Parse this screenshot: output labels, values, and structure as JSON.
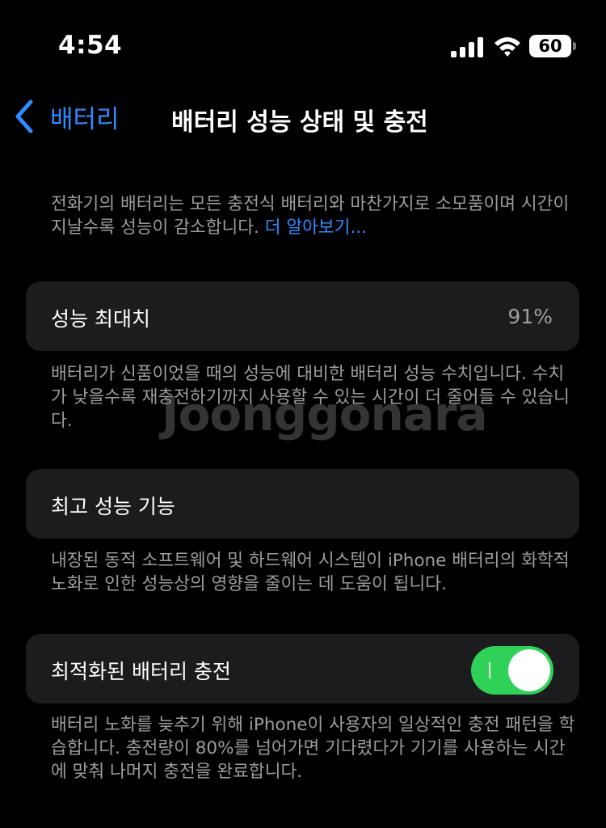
{
  "status_bar": {
    "time": "4:54",
    "battery_level": "60",
    "icons": [
      "signal-icon",
      "wifi-icon",
      "battery-icon"
    ]
  },
  "nav": {
    "back_label": "배터리",
    "title": "배터리 성능 상태 및 충전",
    "back_icon": "chevron-left-icon"
  },
  "intro": {
    "text": "전화기의 배터리는 모든 충전식 배터리와 마찬가지로 소모품이며 시간이 지날수록 성능이 감소합니다. ",
    "link": "더 알아보기..."
  },
  "max_capacity": {
    "label": "성능 최대치",
    "value": "91%",
    "value_percent": 91,
    "footnote": "배터리가 신품이었을 때의 성능에 대비한 배터리 성능 수치입니다. 수치가 낮을수록 재충전하기까지 사용할 수 있는 시간이 더 줄어들 수 있습니다."
  },
  "peak_performance": {
    "label": "최고 성능 기능",
    "footnote": "내장된 동적 소프트웨어 및 하드웨어 시스템이 iPhone 배터리의 화학적 노화로 인한 성능상의 영향을 줄이는 데 도움이 됩니다."
  },
  "optimized_charging": {
    "label": "최적화된 배터리 충전",
    "enabled": true,
    "footnote": "배터리 노화를 늦추기 위해 iPhone이 사용자의 일상적인 충전 패턴을 학습합니다. 충전량이 80%를 넘어가면 기다렸다가 기기를 사용하는 시간에 맞춰 나머지 충전을 완료합니다."
  },
  "watermark": "Joonggonara",
  "colors": {
    "background": "#000000",
    "card": "#1c1c1e",
    "accent_blue": "#2f8cff",
    "toggle_green": "#30d158",
    "secondary_text": "#9c9ca1"
  }
}
